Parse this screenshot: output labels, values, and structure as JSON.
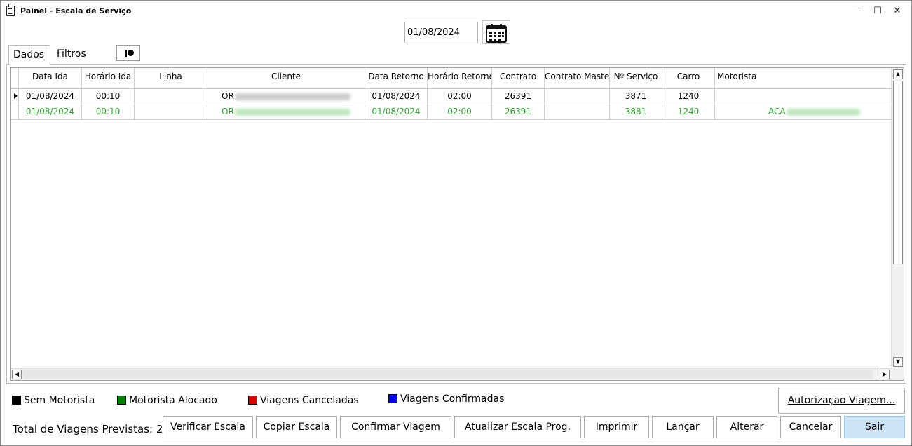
{
  "window": {
    "title": "Painel - Escala de Serviço",
    "minimize": "—",
    "maximize": "☐",
    "close": "✕"
  },
  "date_filter": {
    "value": "01/08/2024"
  },
  "tabs": [
    {
      "label": "Dados",
      "active": true
    },
    {
      "label": "Filtros",
      "active": false
    }
  ],
  "grid": {
    "columns": [
      "Data Ida",
      "Horário Ida",
      "Linha",
      "Cliente",
      "Data Retorno",
      "Horário Retorno",
      "Contrato",
      "Contrato Master",
      "Nº Serviço",
      "Carro",
      "Motorista"
    ],
    "rows": [
      {
        "data_ida": "01/08/2024",
        "horario_ida": "00:10",
        "linha": "",
        "cliente": "OR",
        "data_retorno": "01/08/2024",
        "horario_retorno": "02:00",
        "contrato": "26391",
        "contrato_master": "",
        "n_servico": "3871",
        "carro": "1240",
        "motorista": "",
        "status": "sem-motorista"
      },
      {
        "data_ida": "01/08/2024",
        "horario_ida": "00:10",
        "linha": "",
        "cliente": "OR",
        "data_retorno": "01/08/2024",
        "horario_retorno": "02:00",
        "contrato": "26391",
        "contrato_master": "",
        "n_servico": "3881",
        "carro": "1240",
        "motorista": "ACA",
        "status": "motorista-alocado"
      }
    ]
  },
  "legend": [
    {
      "label": "Sem Motorista",
      "color": "#000000"
    },
    {
      "label": "Motorista Alocado",
      "color": "#008000"
    },
    {
      "label": "Viagens Canceladas",
      "color": "#e00000"
    },
    {
      "label": "Viagens Confirmadas",
      "color": "#0000ee"
    }
  ],
  "footer": {
    "total_label": "Total de Viagens Previstas: 2",
    "autorizacao": "Autorizaçao Viagem...",
    "verificar": "Verificar Escala",
    "copiar": "Copiar Escala",
    "confirmar": "Confirmar Viagem",
    "atualizar": "Atualizar Escala Prog.",
    "imprimir": "Imprimir",
    "lancar": "Lançar",
    "alterar": "Alterar",
    "cancelar": "Cancelar",
    "sair": "Sair"
  },
  "colors": {
    "allocated_text": "#2ea02e",
    "primary_button": "#cce4f7"
  }
}
